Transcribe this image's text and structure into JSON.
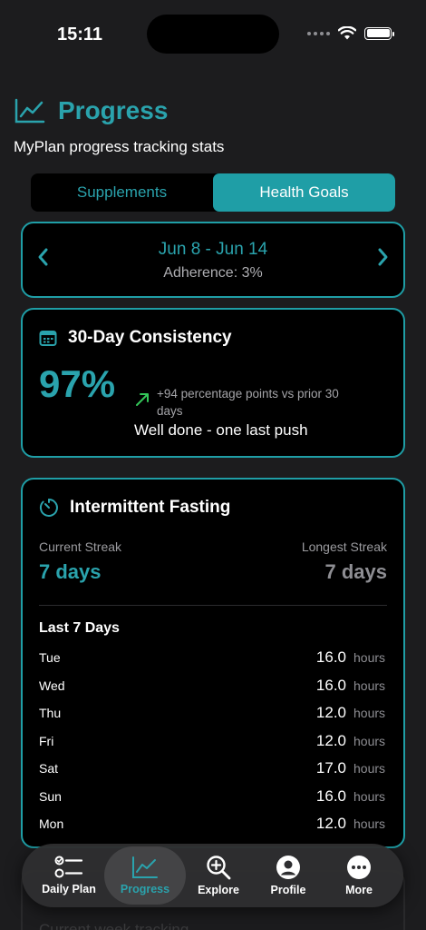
{
  "status_bar": {
    "time": "15:11"
  },
  "header": {
    "title": "Progress",
    "subtitle": "MyPlan progress tracking stats",
    "icon": "chart-line-icon"
  },
  "segment": {
    "options": [
      "Supplements",
      "Health Goals"
    ],
    "selected": "Health Goals"
  },
  "week": {
    "range": "Jun 8 - Jun 14",
    "adherence": "Adherence: 3%"
  },
  "consistency": {
    "title": "30-Day Consistency",
    "percent": "97%",
    "delta": "+94 percentage points vs prior 30 days",
    "message": "Well done - one last push"
  },
  "fasting": {
    "title": "Intermittent Fasting",
    "current_streak_label": "Current Streak",
    "current_streak_value": "7 days",
    "longest_streak_label": "Longest Streak",
    "longest_streak_value": "7 days",
    "last7_title": "Last 7 Days",
    "unit": "hours",
    "days": [
      {
        "day": "Tue",
        "value": "16.0"
      },
      {
        "day": "Wed",
        "value": "16.0"
      },
      {
        "day": "Thu",
        "value": "12.0"
      },
      {
        "day": "Fri",
        "value": "12.0"
      },
      {
        "day": "Sat",
        "value": "17.0"
      },
      {
        "day": "Sun",
        "value": "16.0"
      },
      {
        "day": "Mon",
        "value": "12.0"
      }
    ]
  },
  "next_card": {
    "text": "Current week tracking"
  },
  "tabbar": {
    "tabs": [
      {
        "label": "Daily Plan",
        "icon": "checklist-icon"
      },
      {
        "label": "Progress",
        "icon": "chart-line-icon"
      },
      {
        "label": "Explore",
        "icon": "magnifier-plus-icon"
      },
      {
        "label": "Profile",
        "icon": "person-circle-icon"
      },
      {
        "label": "More",
        "icon": "ellipsis-circle-icon"
      }
    ],
    "active": "Progress"
  },
  "colors": {
    "accent": "#2aa3ad",
    "accent_border": "#1f9ea6",
    "background": "#1c1c1e",
    "card": "#000000",
    "trend_up": "#34c759"
  }
}
